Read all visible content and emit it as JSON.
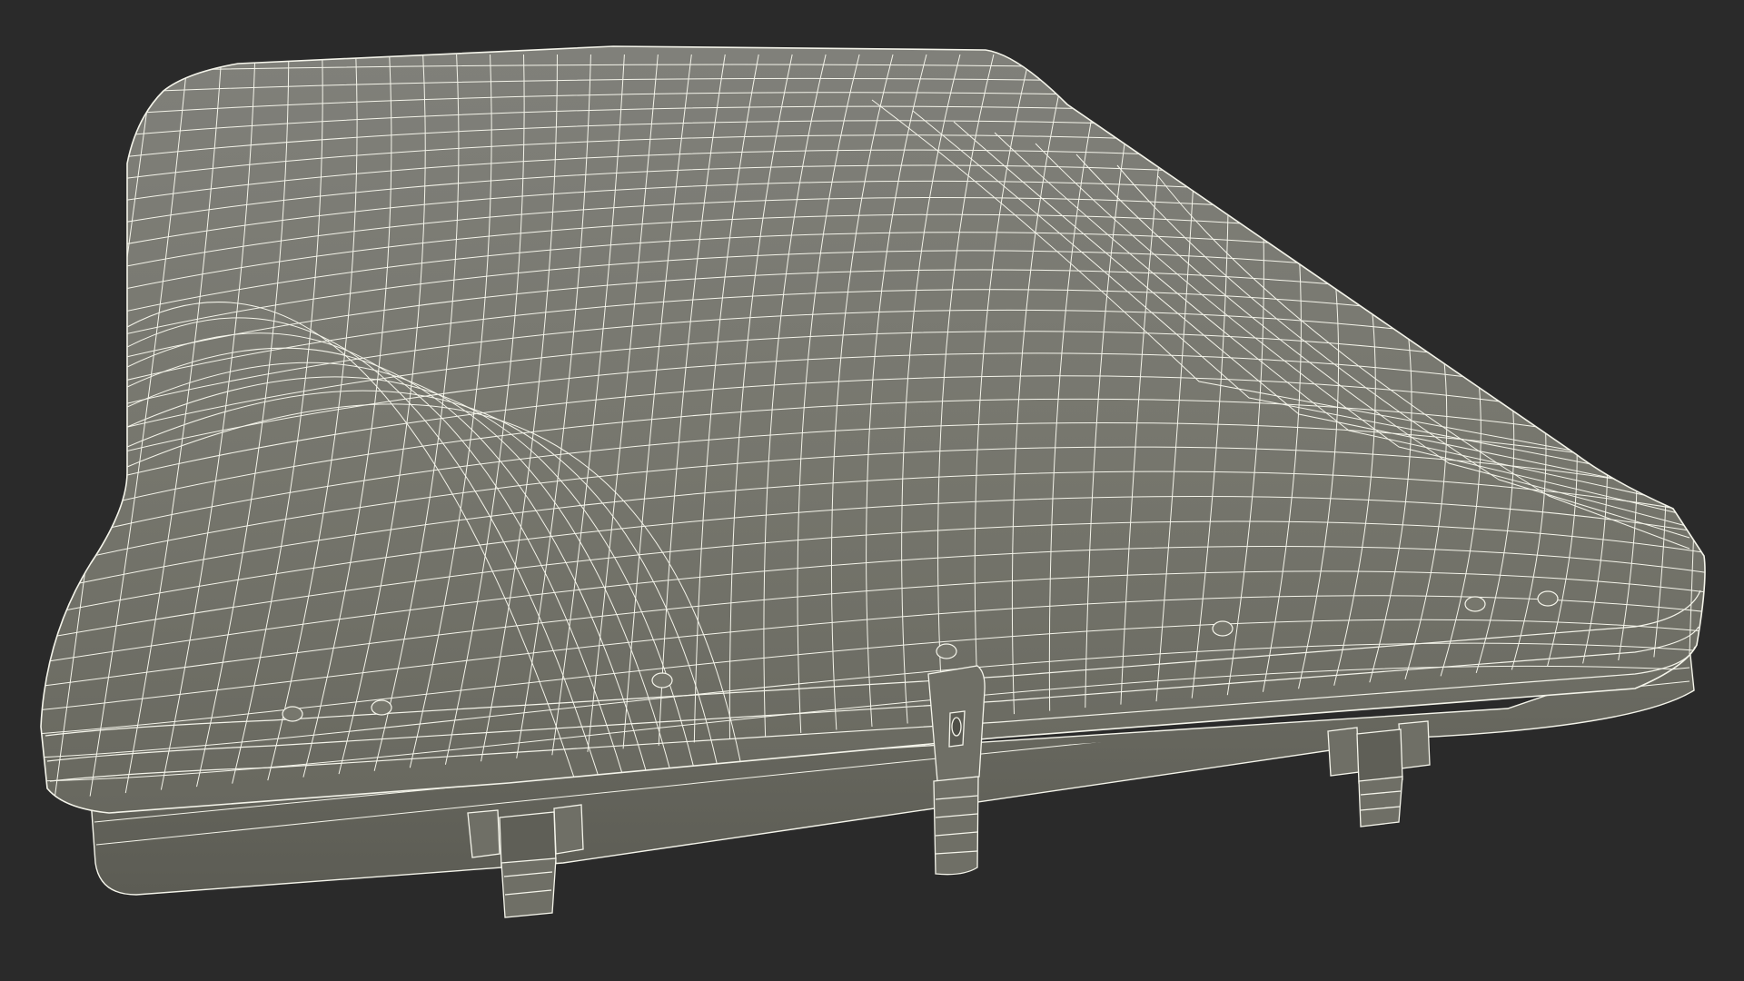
{
  "scene": {
    "subject": "roof-box-wireframe",
    "render_mode": "wireframe",
    "background_color": "#2a2a2a",
    "shell_color": "#77776d",
    "shell_shadow_color": "#616158",
    "wire_color": "#f4f4ea",
    "latch_color": "#6f6f66"
  }
}
